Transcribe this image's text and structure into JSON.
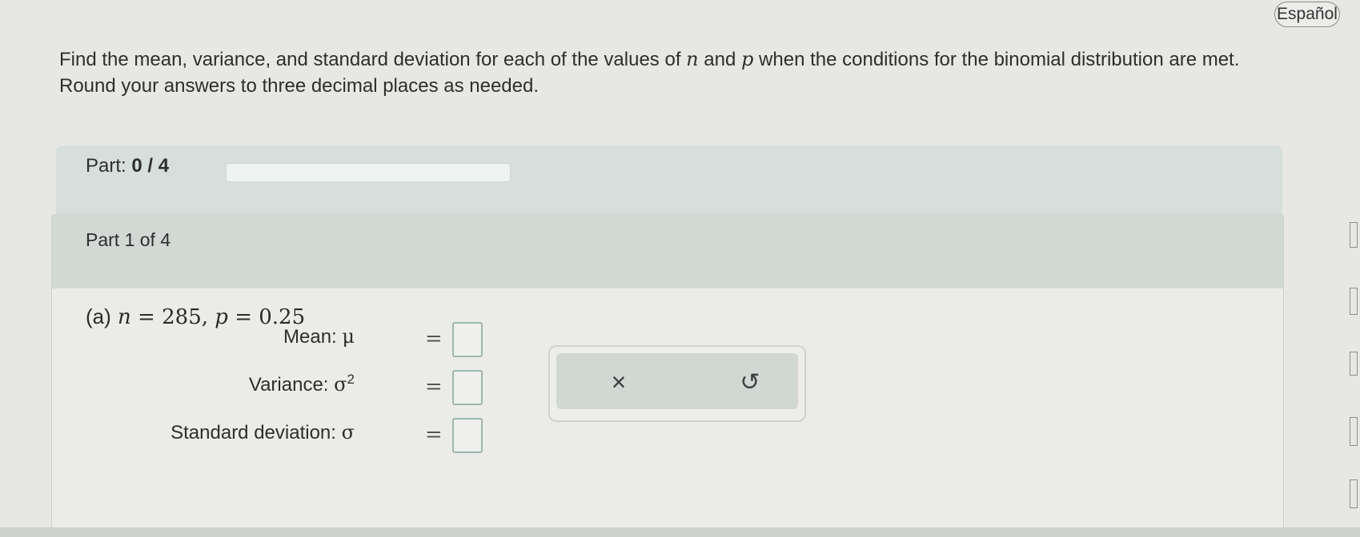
{
  "header": {
    "language_button": "Español"
  },
  "instructions": {
    "pre": "Find the mean, variance, and standard deviation for each of the values of ",
    "var_n": "n",
    "mid1": " and ",
    "var_p": "p",
    "post": " when the conditions for the binomial distribution are met. Round your answers to three decimal places as needed."
  },
  "progress": {
    "label": "Part:",
    "value": "0 / 4",
    "fraction": 0
  },
  "part": {
    "header": "Part 1 of 4",
    "question_label": "(a)",
    "question_n": "n",
    "question_eq1": " = 285, ",
    "question_p": "p",
    "question_eq2": " = 0.25"
  },
  "fields": [
    {
      "label": "Mean: ",
      "symbol": "μ",
      "sup": "",
      "equals": "="
    },
    {
      "label": "Variance: ",
      "symbol": "σ",
      "sup": "2",
      "equals": "="
    },
    {
      "label": "Standard deviation: ",
      "symbol": "σ",
      "sup": "",
      "equals": "="
    }
  ],
  "tools": {
    "clear": "×",
    "undo": "↺"
  }
}
